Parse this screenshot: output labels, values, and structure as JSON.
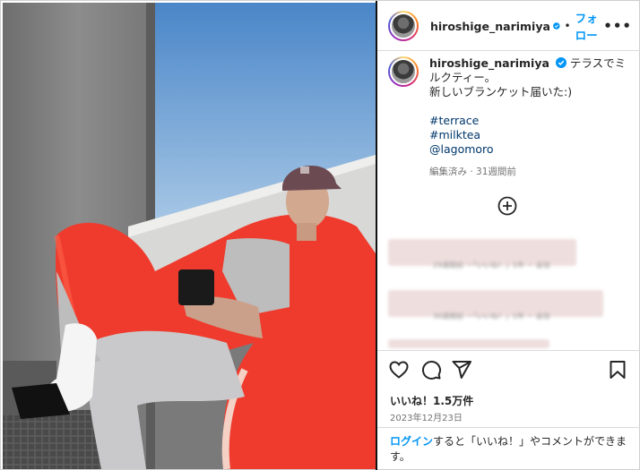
{
  "post": {
    "username": "hiroshige_narimiya",
    "follow_label": "フォロー",
    "dot": "•",
    "more_label": "•••"
  },
  "caption": {
    "username": "hiroshige_narimiya",
    "line1": "テラスでミルクティー。",
    "line2": "新しいブランケット届いた:)",
    "tags": [
      "#terrace",
      "#milktea",
      "@lagomoro"
    ],
    "meta": "編集済み · 31週間前"
  },
  "blurred_comments": [
    {
      "sub": "29週間前 ・「いいね！」1件 ・ 返信"
    },
    {
      "sub": "30週間前 ・「いいね！」1件 ・ 返信"
    }
  ],
  "stats": {
    "likes": "いいね！1.5万件",
    "date": "2023年12月23日"
  },
  "login_prompt": {
    "link": "ログイン",
    "rest": "すると「いいね！」やコメントができます。"
  },
  "colors": {
    "link_blue": "#0095f6",
    "hashtag": "#00376b",
    "verified": "#0095f6",
    "blanket": "#ef3b2d"
  },
  "icons": [
    "verified-badge-icon",
    "more-options-icon",
    "add-comment-icon",
    "heart-icon",
    "comment-icon",
    "share-icon",
    "bookmark-icon"
  ]
}
